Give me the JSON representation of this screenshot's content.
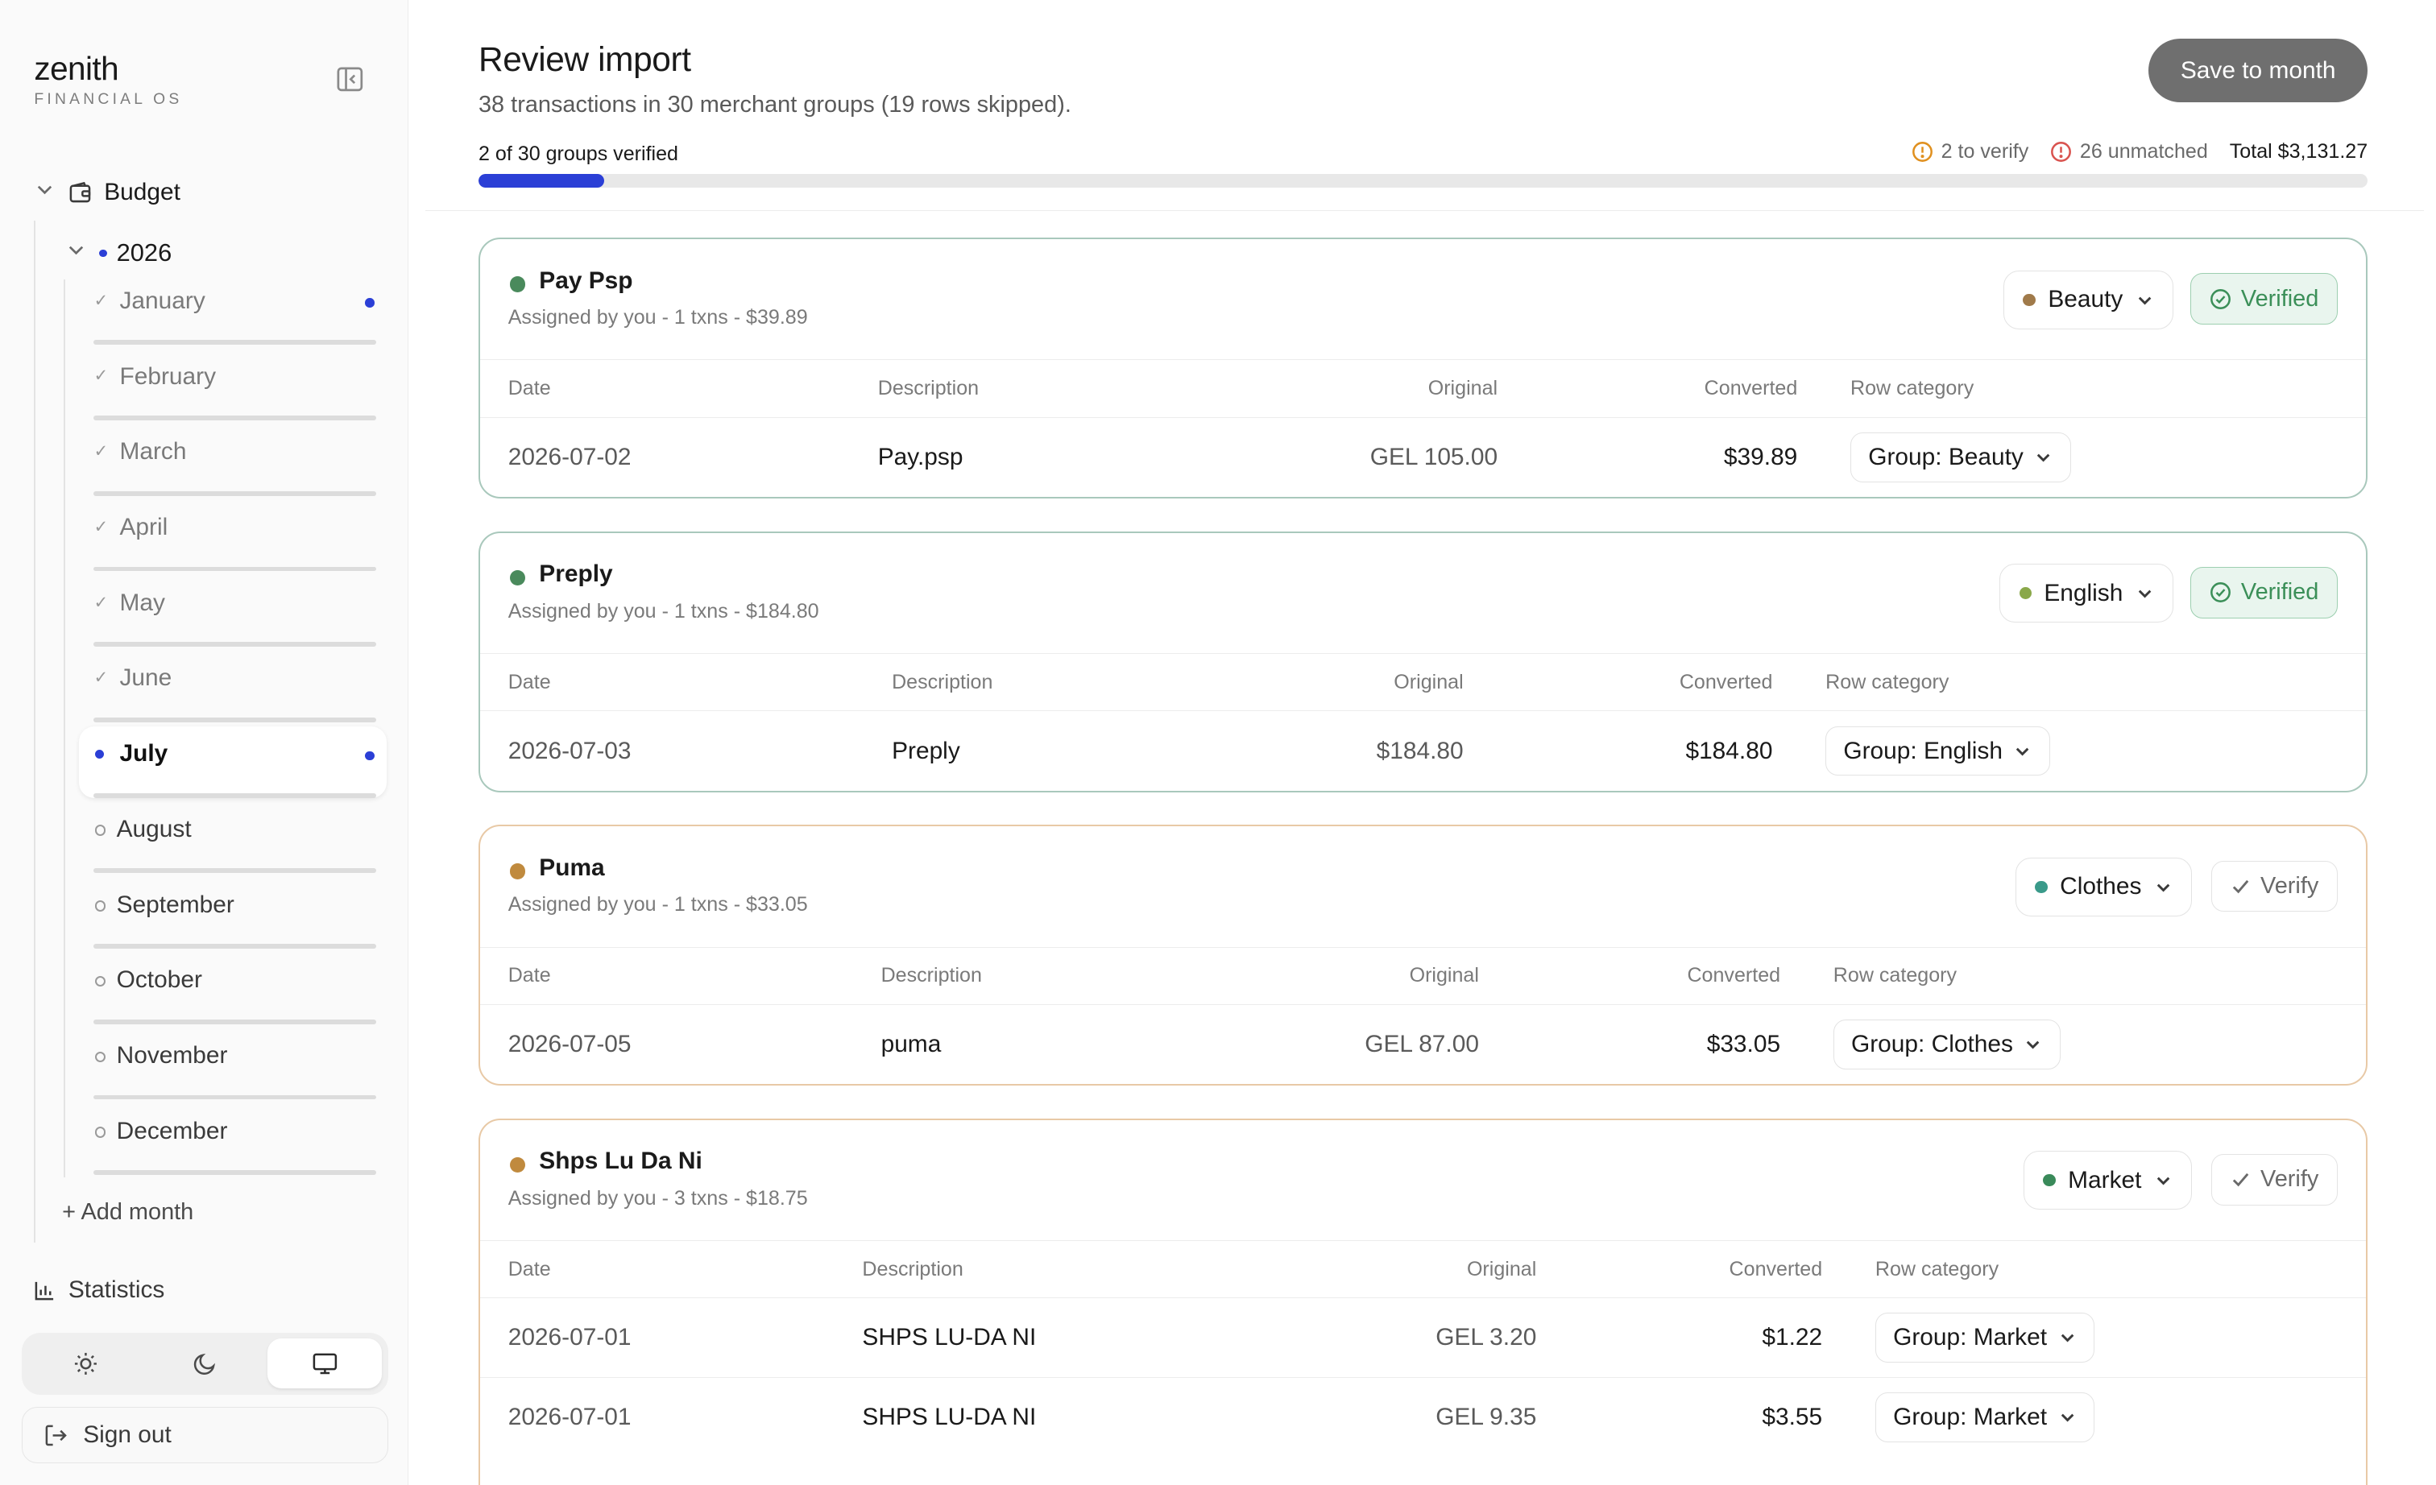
{
  "brand": {
    "name": "zenith",
    "subtitle": "FINANCIAL OS"
  },
  "sidebar": {
    "budget_label": "Budget",
    "year_label": "2026",
    "months": [
      {
        "name": "January",
        "state": "done",
        "flag": true
      },
      {
        "name": "February",
        "state": "done",
        "flag": false
      },
      {
        "name": "March",
        "state": "done",
        "flag": false
      },
      {
        "name": "April",
        "state": "done",
        "flag": false
      },
      {
        "name": "May",
        "state": "done",
        "flag": false
      },
      {
        "name": "June",
        "state": "done",
        "flag": false
      },
      {
        "name": "July",
        "state": "current",
        "flag": true
      },
      {
        "name": "August",
        "state": "todo",
        "flag": false
      },
      {
        "name": "September",
        "state": "todo",
        "flag": false
      },
      {
        "name": "October",
        "state": "todo",
        "flag": false
      },
      {
        "name": "November",
        "state": "todo",
        "flag": false
      },
      {
        "name": "December",
        "state": "todo",
        "flag": false
      }
    ],
    "add_month": "+ Add month",
    "statistics": "Statistics",
    "theme": {
      "options": [
        "light",
        "dark",
        "system"
      ],
      "selected": "system"
    },
    "sign_out": "Sign out"
  },
  "header": {
    "title": "Review import",
    "subtitle": "38 transactions in 30 merchant groups (19 rows skipped).",
    "save_button": "Save to month",
    "progress_label": "2 of 30 groups verified",
    "progress_fraction": 0.0667,
    "to_verify": "2 to verify",
    "unmatched": "26 unmatched",
    "total": "Total $3,131.27"
  },
  "colors": {
    "accent": "#2b3fd6",
    "verified_border": "#a9c8bc",
    "pending_border": "#e8c9a6",
    "warning": "#e0901f",
    "danger": "#d9534f"
  },
  "table_headers": {
    "date": "Date",
    "description": "Description",
    "original": "Original",
    "converted": "Converted",
    "row_category": "Row category"
  },
  "groups": [
    {
      "name": "Pay Psp",
      "meta": "Assigned by you - 1 txns - $39.89",
      "status_color": "#4a8a5c",
      "category": "Beauty",
      "category_color": "#a07a4a",
      "verified": true,
      "status_label": "Verified",
      "rows": [
        {
          "date": "2026-07-02",
          "description": "Pay.psp",
          "original": "GEL 105.00",
          "converted": "$39.89",
          "row_category": "Group: Beauty"
        }
      ]
    },
    {
      "name": "Preply",
      "meta": "Assigned by you - 1 txns - $184.80",
      "status_color": "#4a8a5c",
      "category": "English",
      "category_color": "#8aa84a",
      "verified": true,
      "status_label": "Verified",
      "rows": [
        {
          "date": "2026-07-03",
          "description": "Preply",
          "original": "$184.80",
          "converted": "$184.80",
          "row_category": "Group: English"
        }
      ]
    },
    {
      "name": "Puma",
      "meta": "Assigned by you - 1 txns - $33.05",
      "status_color": "#c08a3e",
      "category": "Clothes",
      "category_color": "#3a9a8a",
      "verified": false,
      "status_label": "Verify",
      "rows": [
        {
          "date": "2026-07-05",
          "description": "puma",
          "original": "GEL 87.00",
          "converted": "$33.05",
          "row_category": "Group: Clothes"
        }
      ]
    },
    {
      "name": "Shps Lu Da Ni",
      "meta": "Assigned by you - 3 txns - $18.75",
      "status_color": "#c08a3e",
      "category": "Market",
      "category_color": "#3a8a5a",
      "verified": false,
      "status_label": "Verify",
      "rows": [
        {
          "date": "2026-07-01",
          "description": "SHPS LU-DA NI",
          "original": "GEL 3.20",
          "converted": "$1.22",
          "row_category": "Group: Market"
        },
        {
          "date": "2026-07-01",
          "description": "SHPS LU-DA NI",
          "original": "GEL 9.35",
          "converted": "$3.55",
          "row_category": "Group: Market"
        }
      ]
    }
  ]
}
